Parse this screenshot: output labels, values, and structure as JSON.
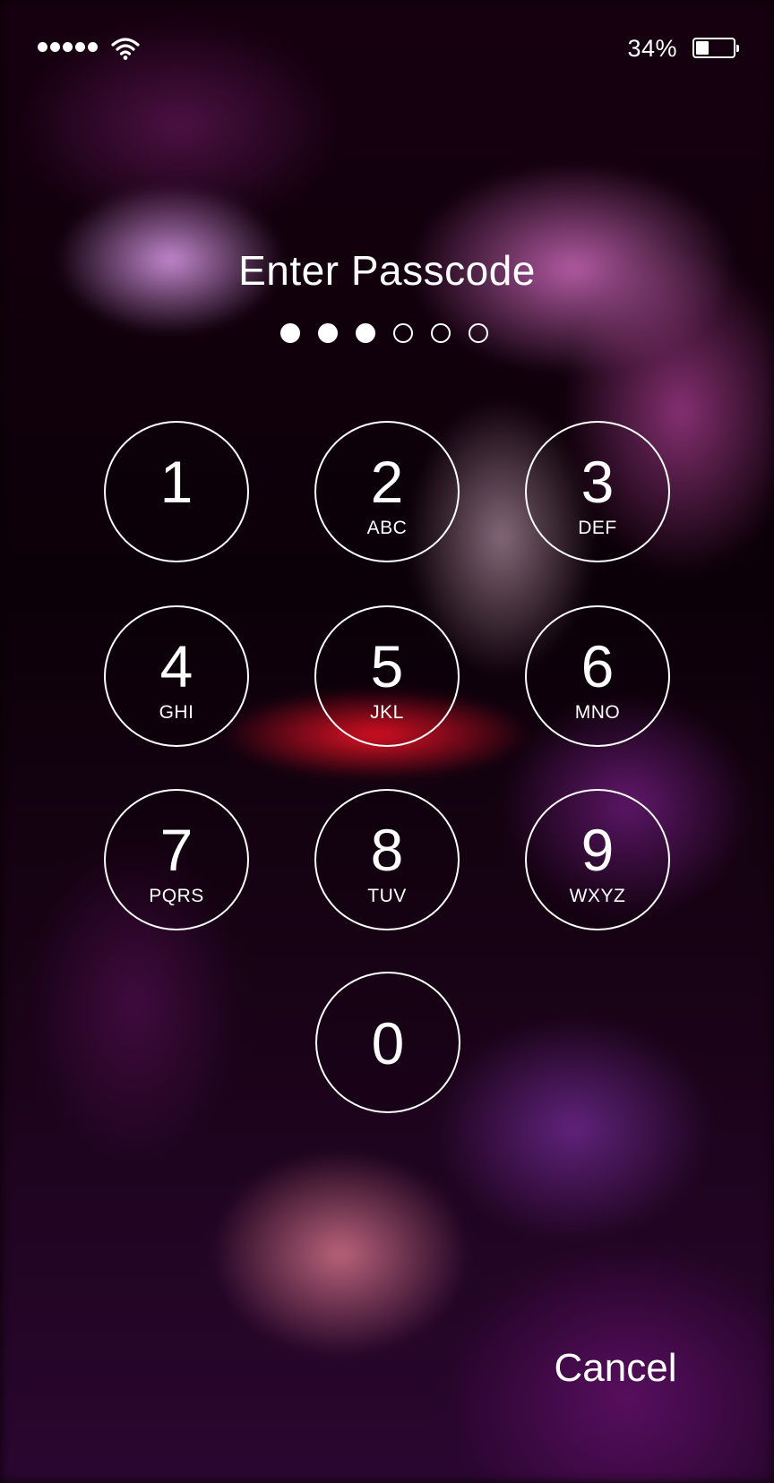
{
  "status_bar": {
    "signal_icon": "signal-dots-icon",
    "wifi_icon": "wifi-icon",
    "battery_percent": "34%",
    "battery_level": 0.34,
    "battery_icon": "battery-icon"
  },
  "title": "Enter Passcode",
  "passcode": {
    "length": 6,
    "entered": 3
  },
  "keypad": [
    {
      "digit": "1",
      "letters": ""
    },
    {
      "digit": "2",
      "letters": "ABC"
    },
    {
      "digit": "3",
      "letters": "DEF"
    },
    {
      "digit": "4",
      "letters": "GHI"
    },
    {
      "digit": "5",
      "letters": "JKL"
    },
    {
      "digit": "6",
      "letters": "MNO"
    },
    {
      "digit": "7",
      "letters": "PQRS"
    },
    {
      "digit": "8",
      "letters": "TUV"
    },
    {
      "digit": "9",
      "letters": "WXYZ"
    },
    {
      "digit": "0",
      "letters": ""
    }
  ],
  "cancel_label": "Cancel",
  "colors": {
    "text": "#ffffff",
    "wallpaper_accent": "#c040c0"
  }
}
